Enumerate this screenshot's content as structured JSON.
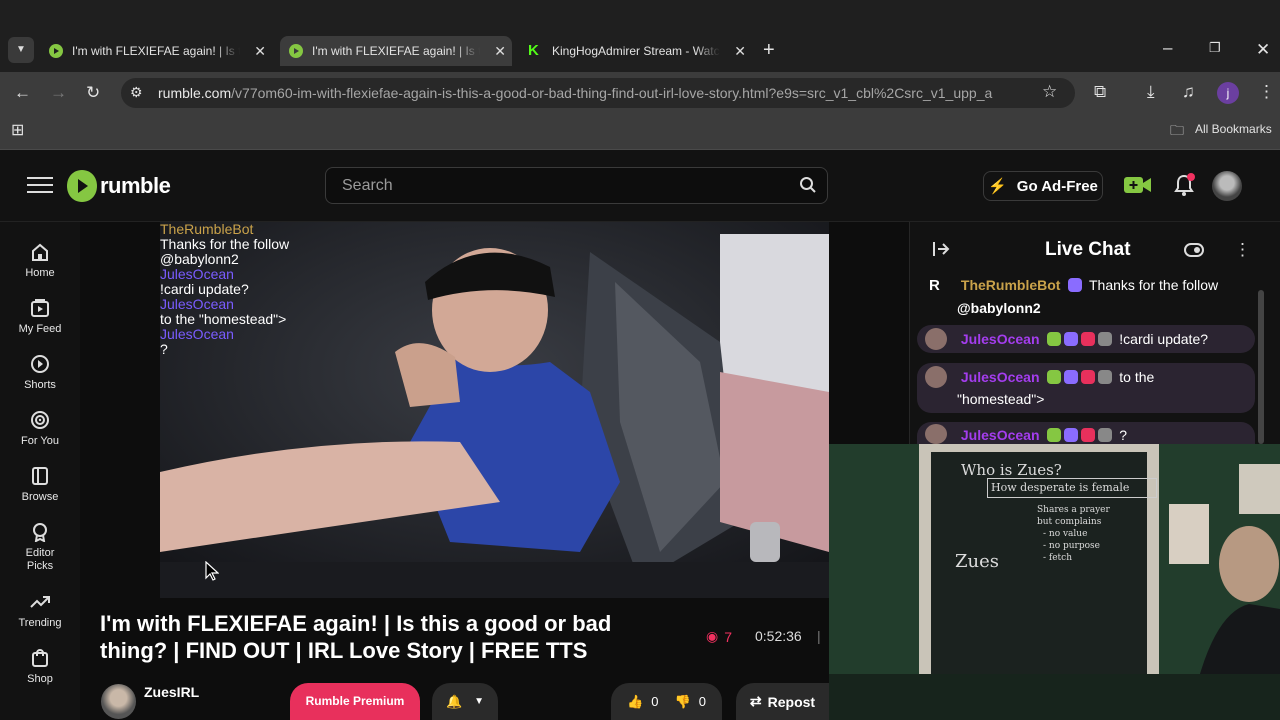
{
  "browser": {
    "tabs": [
      {
        "title": "I'm with FLEXIEFAE again! | Is this",
        "active": false
      },
      {
        "title": "I'm with FLEXIEFAE again! | Is this",
        "active": true
      },
      {
        "title": "KingHogAdmirer Stream - Watch",
        "active": false
      }
    ],
    "url_domain": "rumble.com",
    "url_path": "/v77om60-im-with-flexiefae-again-is-this-a-good-or-bad-thing-find-out-irl-love-story.html?e9s=src_v1_cbl%2Csrc_v1_upp_a",
    "bookmarks_label": "All Bookmarks",
    "profile_initial": "j"
  },
  "header": {
    "logo_text": "rumble",
    "search_placeholder": "Search",
    "go_ad_free": "Go Ad-Free"
  },
  "sidebar": [
    {
      "label": "Home",
      "icon": "home-icon"
    },
    {
      "label": "My Feed",
      "icon": "feed-icon"
    },
    {
      "label": "Shorts",
      "icon": "shorts-icon"
    },
    {
      "label": "For You",
      "icon": "for-you-icon"
    },
    {
      "label": "Browse",
      "icon": "browse-icon"
    },
    {
      "label": "Editor Picks",
      "icon": "editor-picks-icon"
    },
    {
      "label": "Trending",
      "icon": "trending-icon"
    },
    {
      "label": "Shop",
      "icon": "shop-icon"
    }
  ],
  "video_overlay": [
    {
      "text": "TheRumbleBot",
      "color": "#c9a24a"
    },
    {
      "text": "Thanks for the follow",
      "color": "#ffffff"
    },
    {
      "text": "@babylonn2",
      "color": "#ffffff"
    },
    {
      "text": "JulesOcean",
      "color": "#7a5cff"
    },
    {
      "text": "!cardi update?",
      "color": "#ffffff"
    },
    {
      "text": "JulesOcean",
      "color": "#7a5cff"
    },
    {
      "text": "to the \"homestead\">",
      "color": "#ffffff"
    },
    {
      "text": "JulesOcean",
      "color": "#7a5cff"
    },
    {
      "text": "?",
      "color": "#ffffff"
    }
  ],
  "video": {
    "title": "I'm with FLEXIEFAE again! | Is this a good or bad thing? | FIND OUT | IRL Love Story | FREE TTS",
    "viewers": "7",
    "duration": "0:52:36",
    "channel": "ZuesIRL",
    "premium_button": "Rumble Premium",
    "likes": "0",
    "dislikes": "0",
    "repost": "Repost"
  },
  "chat": {
    "title": "Live Chat",
    "messages": [
      {
        "user": "TheRumbleBot",
        "text": "Thanks for the follow",
        "text2": "@babylonn2",
        "bot": true
      },
      {
        "user": "JulesOcean",
        "text": "!cardi update?"
      },
      {
        "user": "JulesOcean",
        "text": "to the",
        "text2": "\"homestead\">"
      },
      {
        "user": "JulesOcean",
        "text": "?"
      }
    ]
  },
  "webcam": {
    "board_lines": [
      "Who is Zues?",
      "How desperate is female",
      "Shares a prayer",
      "but complains",
      "- no value",
      "- no purpose",
      "- fetch",
      "Zues"
    ]
  },
  "colors": {
    "brand_green": "#85c742",
    "chat_name": "#a43dee",
    "viewer_red": "#f23160",
    "premium_pink": "#e8305c"
  }
}
